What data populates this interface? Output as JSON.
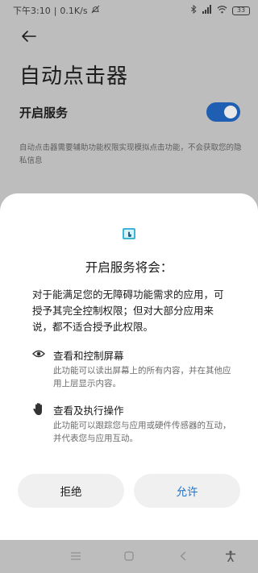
{
  "status_bar": {
    "time": "下午3:10",
    "network_speed": "0.1K/s",
    "battery": "33",
    "icons": [
      "bluetooth-icon",
      "signal-icon",
      "wifi-icon",
      "battery-icon",
      "mute-icon"
    ]
  },
  "page": {
    "title": "自动点击器",
    "setting_label": "开启服务",
    "toggle_on": true,
    "description": "自动点击器需要辅助功能权限实现模拟点击功能，不会获取您的隐私信息"
  },
  "dialog": {
    "title": "开启服务将会：",
    "intro": "对于能满足您的无障碍功能需求的应用，可授予其完全控制权限；但对大部分应用来说，都不适合授予此权限。",
    "permissions": [
      {
        "icon": "eye-icon",
        "title": "查看和控制屏幕",
        "description": "此功能可以读出屏幕上的所有内容，并在其他应用上层显示内容。"
      },
      {
        "icon": "hand-icon",
        "title": "查看及执行操作",
        "description": "此功能可以跟踪您与应用或硬件传感器的互动，并代表您与应用互动。"
      }
    ],
    "deny_label": "拒绝",
    "allow_label": "允许"
  },
  "colors": {
    "accent": "#1d72c8",
    "toggle": "#1f5fb3",
    "scrim": "#bdbdbd"
  }
}
